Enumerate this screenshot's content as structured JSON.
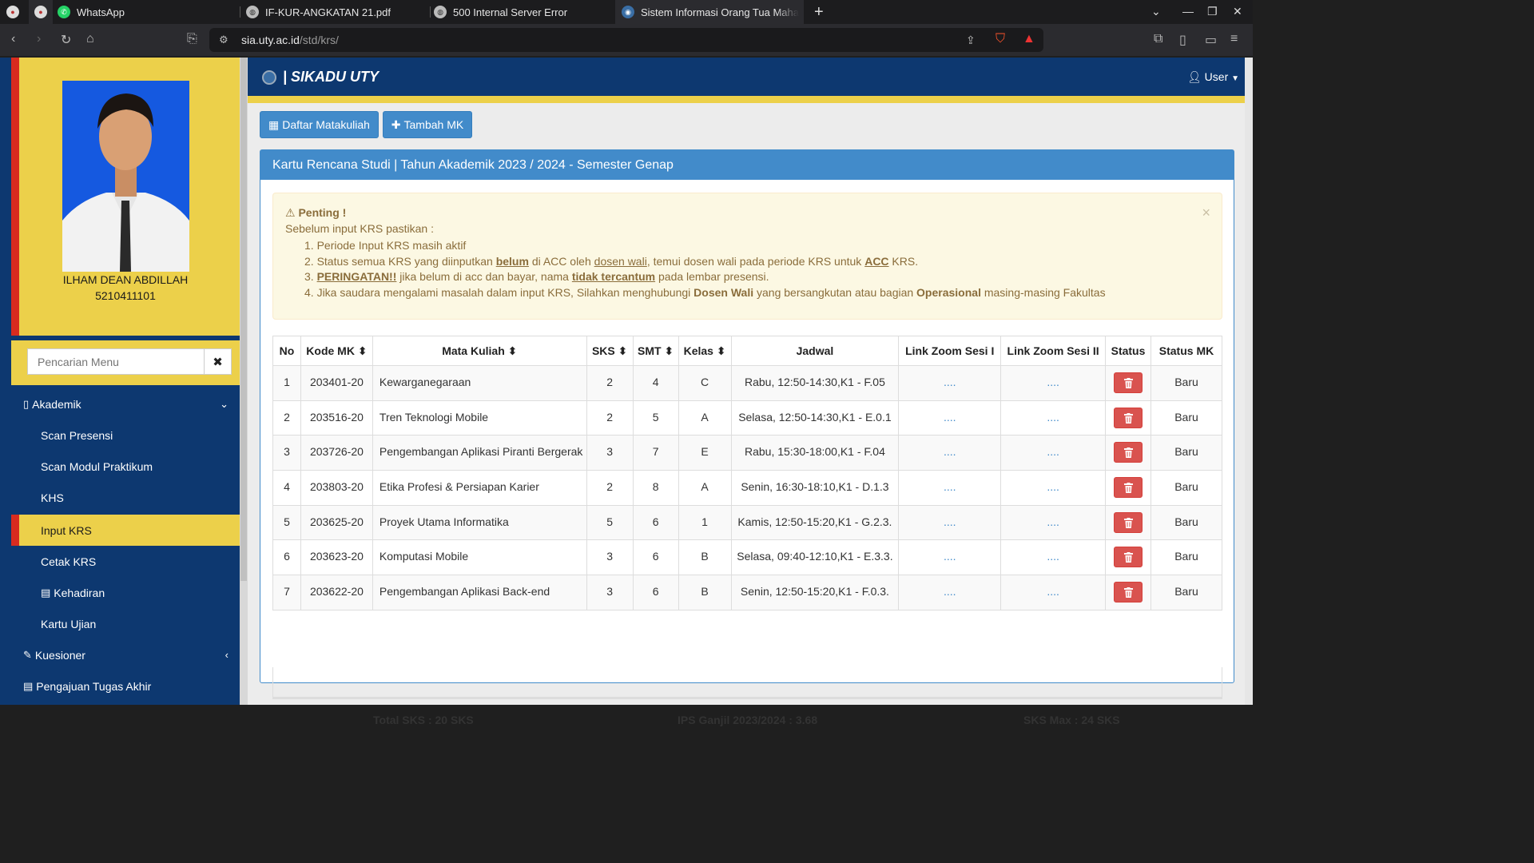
{
  "browser": {
    "tabs": [
      {
        "title": "WhatsApp"
      },
      {
        "title": "IF-KUR-ANGKATAN 21.pdf"
      },
      {
        "title": "500 Internal Server Error"
      },
      {
        "title": "Sistem Informasi Orang Tua Mahasisw"
      }
    ],
    "url_host": "sia.uty.ac.id",
    "url_path": "/std/krs/",
    "new_tab": "+"
  },
  "app": {
    "brand": "| SIKADU UTY",
    "user_menu": "User"
  },
  "student": {
    "name": "ILHAM DEAN ABDILLAH",
    "id": "5210411101"
  },
  "sidebar": {
    "search_placeholder": "Pencarian Menu",
    "items": [
      {
        "label": "Akademik"
      },
      {
        "label": "Scan Presensi"
      },
      {
        "label": "Scan Modul Praktikum"
      },
      {
        "label": "KHS"
      },
      {
        "label": "Input KRS"
      },
      {
        "label": "Cetak KRS"
      },
      {
        "label": "Kehadiran"
      },
      {
        "label": "Kartu Ujian"
      },
      {
        "label": "Kuesioner"
      },
      {
        "label": "Pengajuan Tugas Akhir"
      }
    ]
  },
  "toolbar": {
    "list_button": "Daftar Matakuliah",
    "add_button": "Tambah MK"
  },
  "panel": {
    "title": "Kartu Rencana Studi | Tahun Akademik 2023 / 2024 - Semester Genap"
  },
  "alert": {
    "title": "Penting !",
    "intro": "Sebelum input KRS pastikan :",
    "item1": "1. Periode Input KRS masih aktif",
    "item2_a": "2. Status semua KRS yang diinputkan ",
    "item2_b": "belum",
    "item2_c": " di ACC oleh ",
    "item2_d": "dosen wali",
    "item2_e": ", temui dosen wali pada periode KRS untuk ",
    "item2_f": "ACC",
    "item2_g": " KRS.",
    "item3_a": "3. ",
    "item3_b": "PERINGATAN!!",
    "item3_c": " jika belum di acc dan bayar, nama ",
    "item3_d": "tidak tercantum",
    "item3_e": " pada lembar presensi.",
    "item4_a": "4. Jika saudara mengalami masalah dalam input KRS, Silahkan menghubungi ",
    "item4_b": "Dosen Wali",
    "item4_c": " yang bersangkutan atau bagian ",
    "item4_d": "Operasional",
    "item4_e": " masing-masing Fakultas"
  },
  "table": {
    "headers": [
      "No",
      "Kode MK",
      "Mata Kuliah",
      "SKS",
      "SMT",
      "Kelas",
      "Jadwal",
      "Link Zoom Sesi I",
      "Link Zoom Sesi II",
      "Status",
      "Status MK"
    ],
    "rows": [
      {
        "no": "1",
        "kode": "203401-20",
        "mk": "Kewarganegaraan",
        "sks": "2",
        "smt": "4",
        "kelas": "C",
        "jadwal": "Rabu, 12:50-14:30,K1 - F.05",
        "zoom1": "....",
        "zoom2": "....",
        "status_mk": "Baru"
      },
      {
        "no": "2",
        "kode": "203516-20",
        "mk": "Tren Teknologi Mobile",
        "sks": "2",
        "smt": "5",
        "kelas": "A",
        "jadwal": "Selasa, 12:50-14:30,K1 - E.0.1",
        "zoom1": "....",
        "zoom2": "....",
        "status_mk": "Baru"
      },
      {
        "no": "3",
        "kode": "203726-20",
        "mk": "Pengembangan Aplikasi Piranti Bergerak",
        "sks": "3",
        "smt": "7",
        "kelas": "E",
        "jadwal": "Rabu, 15:30-18:00,K1 - F.04",
        "zoom1": "....",
        "zoom2": "....",
        "status_mk": "Baru"
      },
      {
        "no": "4",
        "kode": "203803-20",
        "mk": "Etika Profesi & Persiapan Karier",
        "sks": "2",
        "smt": "8",
        "kelas": "A",
        "jadwal": "Senin, 16:30-18:10,K1 - D.1.3",
        "zoom1": "....",
        "zoom2": "....",
        "status_mk": "Baru"
      },
      {
        "no": "5",
        "kode": "203625-20",
        "mk": "Proyek Utama Informatika",
        "sks": "5",
        "smt": "6",
        "kelas": "1",
        "jadwal": "Kamis, 12:50-15:20,K1 - G.2.3.",
        "zoom1": "....",
        "zoom2": "....",
        "status_mk": "Baru"
      },
      {
        "no": "6",
        "kode": "203623-20",
        "mk": "Komputasi Mobile",
        "sks": "3",
        "smt": "6",
        "kelas": "B",
        "jadwal": "Selasa, 09:40-12:10,K1 - E.3.3.",
        "zoom1": "....",
        "zoom2": "....",
        "status_mk": "Baru"
      },
      {
        "no": "7",
        "kode": "203622-20",
        "mk": "Pengembangan Aplikasi Back-end",
        "sks": "3",
        "smt": "6",
        "kelas": "B",
        "jadwal": "Senin, 12:50-15:20,K1 - F.0.3.",
        "zoom1": "....",
        "zoom2": "....",
        "status_mk": "Baru"
      }
    ]
  },
  "summary": {
    "total_sks": "Total SKS : 20 SKS",
    "ips": "IPS Ganjil 2023/2024 : 3.68",
    "sks_max": "SKS Max : 24 SKS"
  },
  "colors": {
    "navy": "#0d3870",
    "yellow": "#ecd04a",
    "red": "#d82b1f",
    "primary": "#428bca",
    "danger": "#d9534f"
  }
}
